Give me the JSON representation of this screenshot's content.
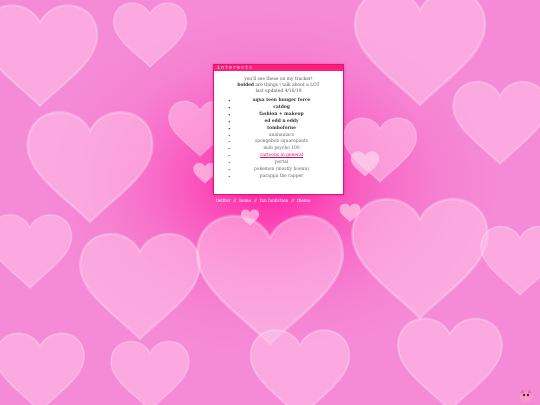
{
  "panel": {
    "title": "interests",
    "intro_line1": "you'll see these on my tracker!",
    "intro_bold": "bolded",
    "intro_line2_rest": " are things i talk about a LOT",
    "updated": "last updated 4/16/19"
  },
  "interests": [
    {
      "label": "aqua teen hunger force",
      "style": "bold"
    },
    {
      "label": "catdog",
      "style": "bold"
    },
    {
      "label": "fashion + makeup",
      "style": "bold"
    },
    {
      "label": "ed edd n eddy",
      "style": "bold"
    },
    {
      "label": "tomboforne",
      "style": "bold"
    },
    {
      "label": "animaniacs",
      "style": "normal"
    },
    {
      "label": "spongebob squarepants",
      "style": "normal"
    },
    {
      "label": "mob psycho 100",
      "style": "normal"
    },
    {
      "label": "cartoons in general",
      "style": "link"
    },
    {
      "label": "portal",
      "style": "normal"
    },
    {
      "label": "pokemon (mostly hoenn)",
      "style": "normal"
    },
    {
      "label": "parappa the rapper",
      "style": "normal"
    }
  ],
  "nav": {
    "twitter": "twitter",
    "sep": "//",
    "home": "home",
    "fun": "fun fanfiction",
    "theme": "theme"
  },
  "colors": {
    "bg": "#f58ad6",
    "accent": "#ff1f78",
    "link": "#d60c77"
  },
  "icons": {
    "corner": "pokemon-sprite-icon"
  }
}
